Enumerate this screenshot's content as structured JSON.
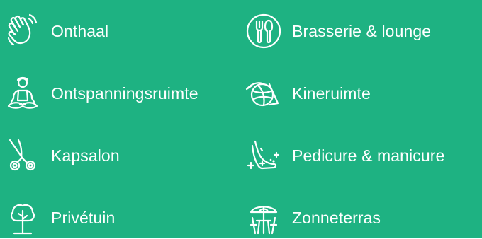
{
  "facilities": [
    {
      "label": "Onthaal",
      "icon": "waving-hand-icon"
    },
    {
      "label": "Brasserie & lounge",
      "icon": "fork-spoon-icon"
    },
    {
      "label": "Ontspanningsruimte",
      "icon": "meditation-icon"
    },
    {
      "label": "Kineruimte",
      "icon": "exercise-ball-icon"
    },
    {
      "label": "Kapsalon",
      "icon": "scissors-icon"
    },
    {
      "label": "Pedicure & manicure",
      "icon": "foot-icon"
    },
    {
      "label": "Privétuin",
      "icon": "tree-icon"
    },
    {
      "label": "Zonneterras",
      "icon": "parasol-table-icon"
    }
  ],
  "colors": {
    "background": "#1eb282",
    "foreground": "#ffffff"
  }
}
